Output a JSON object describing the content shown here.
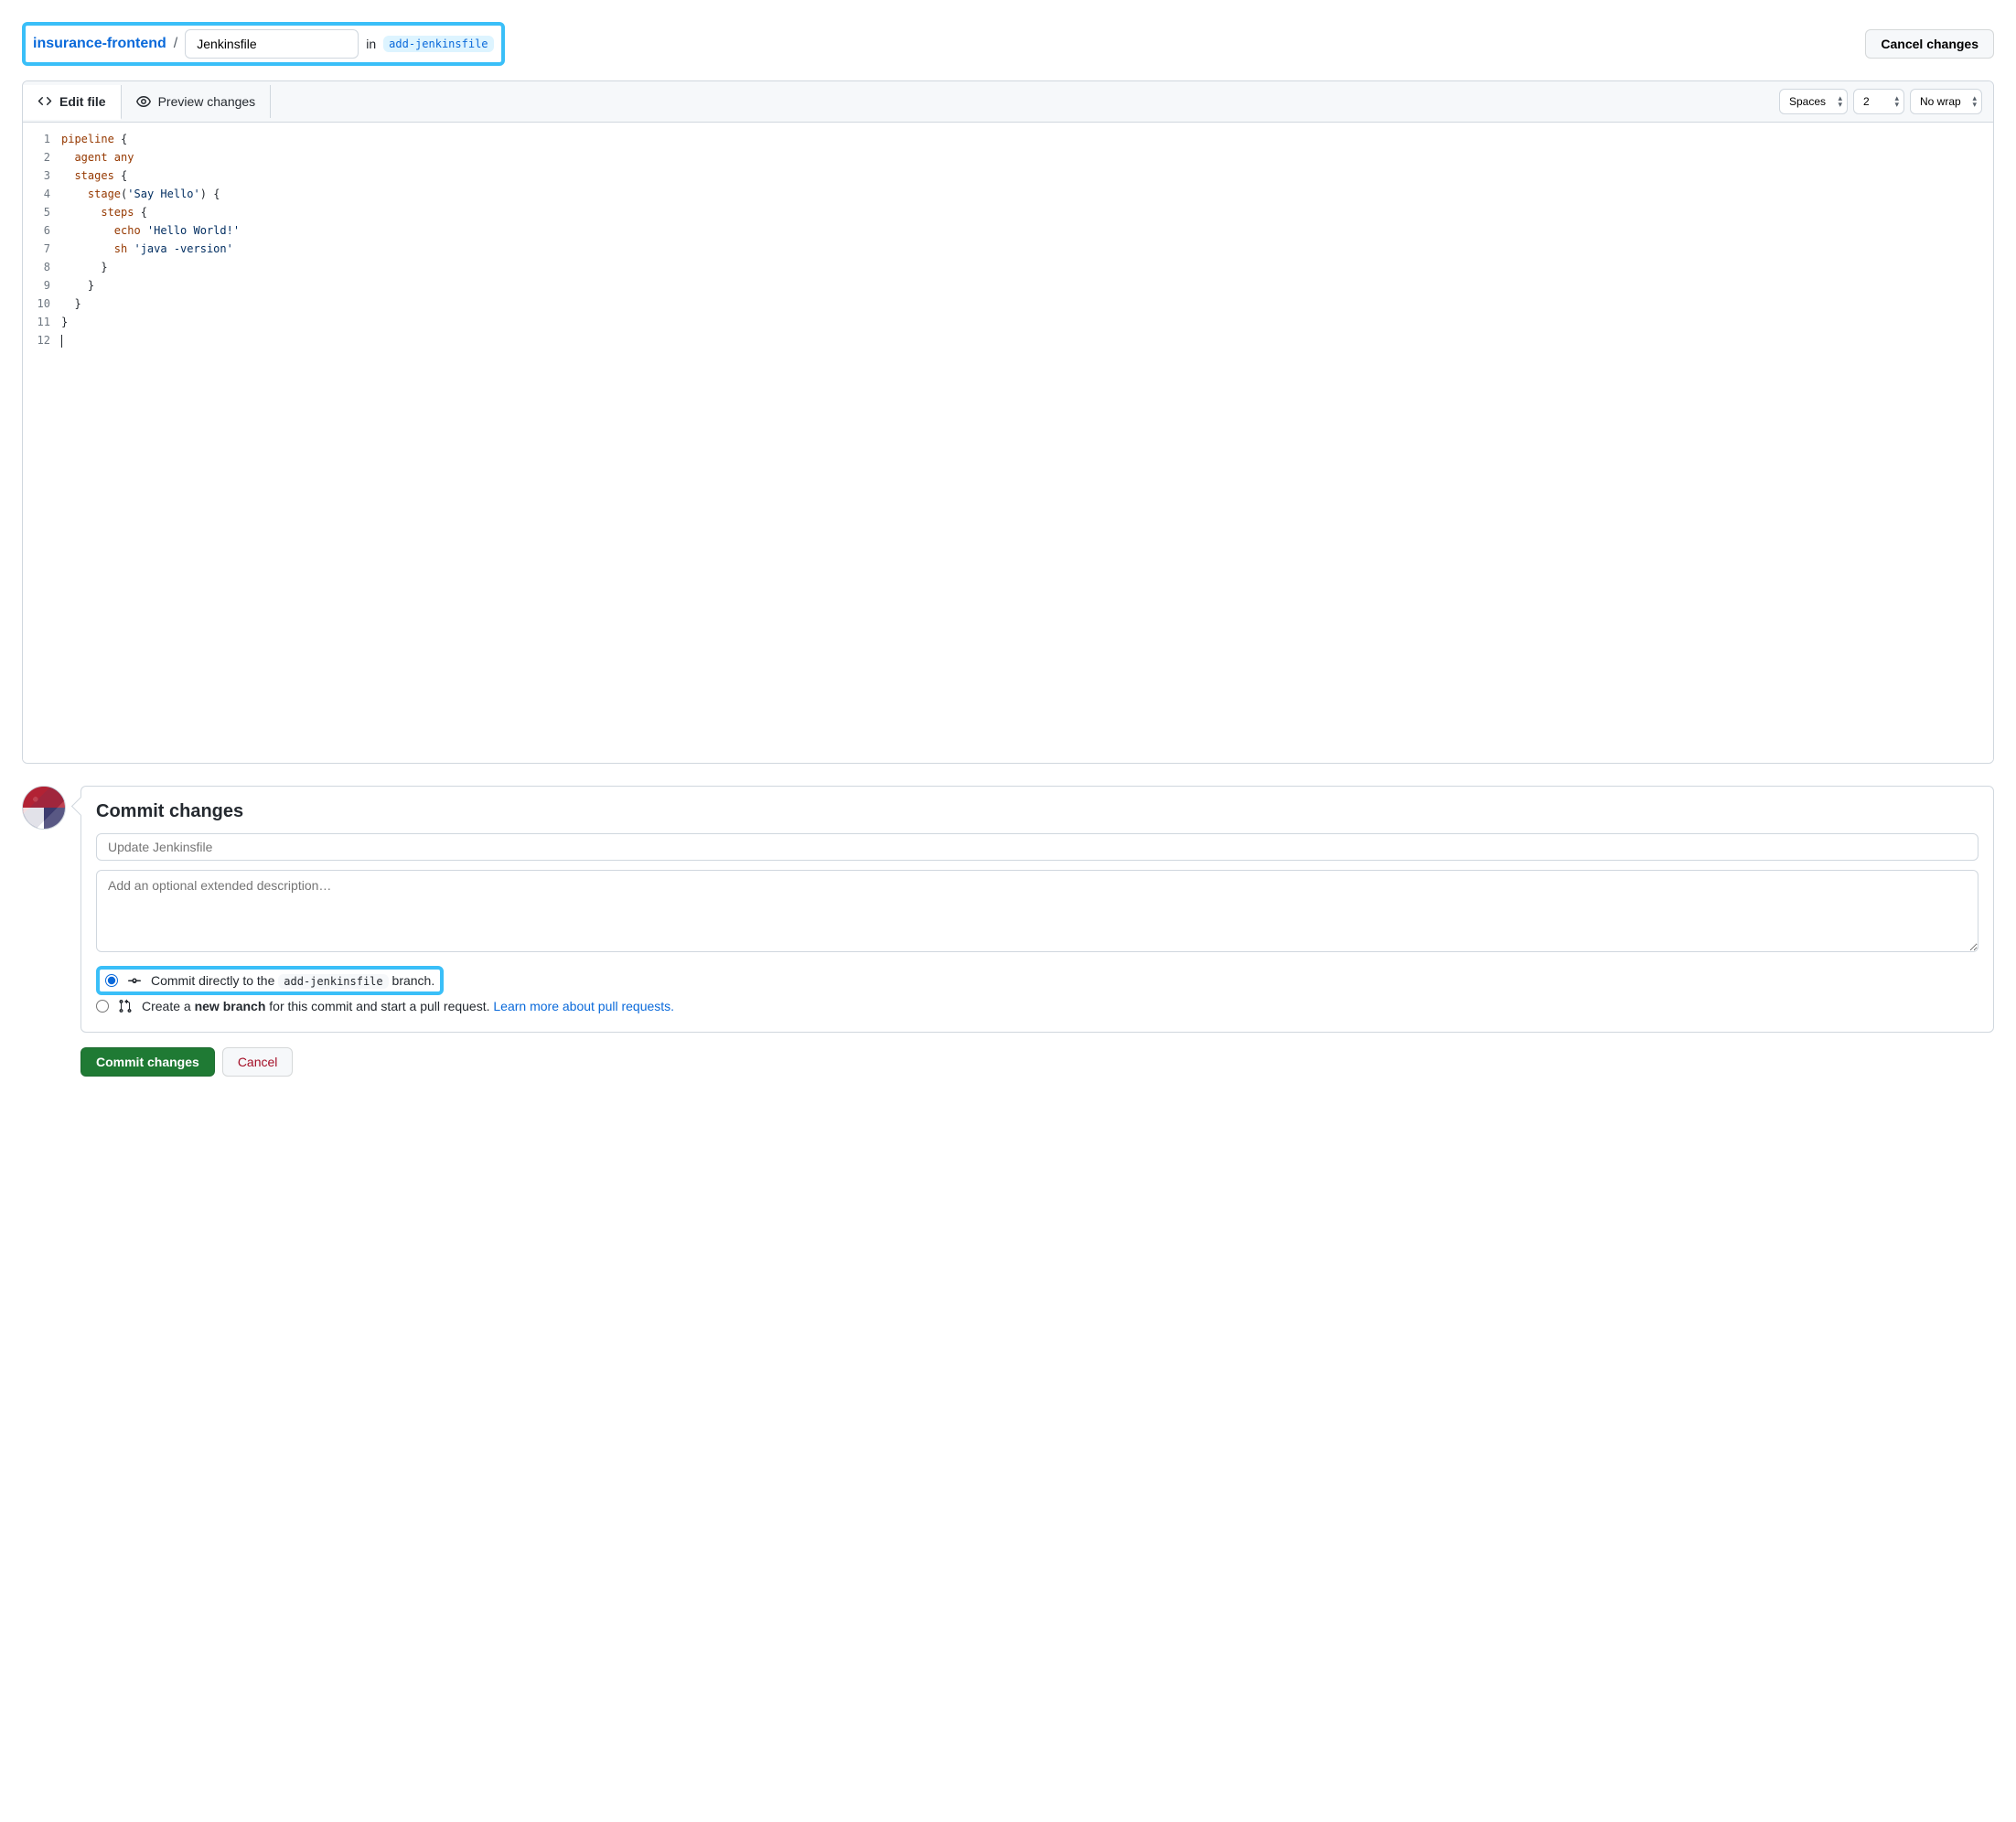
{
  "breadcrumb": {
    "repo": "insurance-frontend",
    "sep": "/",
    "filename": "Jenkinsfile",
    "in_label": "in",
    "branch": "add-jenkinsfile"
  },
  "top_actions": {
    "cancel": "Cancel changes"
  },
  "tabs": {
    "edit": "Edit file",
    "preview": "Preview changes"
  },
  "editor_controls": {
    "indent_mode": "Spaces",
    "indent_size": "2",
    "wrap": "No wrap"
  },
  "code": {
    "line_numbers": [
      "1",
      "2",
      "3",
      "4",
      "5",
      "6",
      "7",
      "8",
      "9",
      "10",
      "11",
      "12"
    ],
    "lines": [
      {
        "indent": "",
        "tokens": [
          {
            "t": "pipeline",
            "c": "tok-prop"
          },
          {
            "t": " {",
            "c": "tok-brace"
          }
        ]
      },
      {
        "indent": "  ",
        "tokens": [
          {
            "t": "agent any",
            "c": "tok-prop"
          }
        ]
      },
      {
        "indent": "  ",
        "tokens": [
          {
            "t": "stages",
            "c": "tok-prop"
          },
          {
            "t": " {",
            "c": "tok-brace"
          }
        ]
      },
      {
        "indent": "    ",
        "tokens": [
          {
            "t": "stage",
            "c": "tok-prop"
          },
          {
            "t": "(",
            "c": "tok-brace"
          },
          {
            "t": "'Say Hello'",
            "c": "tok-str"
          },
          {
            "t": ") {",
            "c": "tok-brace"
          }
        ]
      },
      {
        "indent": "      ",
        "tokens": [
          {
            "t": "steps",
            "c": "tok-prop"
          },
          {
            "t": " {",
            "c": "tok-brace"
          }
        ]
      },
      {
        "indent": "        ",
        "tokens": [
          {
            "t": "echo ",
            "c": "tok-prop"
          },
          {
            "t": "'Hello World!'",
            "c": "tok-str"
          }
        ]
      },
      {
        "indent": "        ",
        "tokens": [
          {
            "t": "sh ",
            "c": "tok-prop"
          },
          {
            "t": "'java -version'",
            "c": "tok-str"
          }
        ]
      },
      {
        "indent": "      ",
        "tokens": [
          {
            "t": "}",
            "c": "tok-brace"
          }
        ]
      },
      {
        "indent": "    ",
        "tokens": [
          {
            "t": "}",
            "c": "tok-brace"
          }
        ]
      },
      {
        "indent": "  ",
        "tokens": [
          {
            "t": "}",
            "c": "tok-brace"
          }
        ]
      },
      {
        "indent": "",
        "tokens": [
          {
            "t": "}",
            "c": "tok-brace"
          }
        ]
      },
      {
        "indent": "",
        "tokens": [],
        "cursor": true
      }
    ]
  },
  "commit": {
    "heading": "Commit changes",
    "summary_placeholder": "Update Jenkinsfile",
    "description_placeholder": "Add an optional extended description…",
    "opt_direct_pre": "Commit directly to the ",
    "opt_direct_branch": "add-jenkinsfile",
    "opt_direct_post": " branch.",
    "opt_newbranch_pre": "Create a ",
    "opt_newbranch_bold": "new branch",
    "opt_newbranch_post": " for this commit and start a pull request. ",
    "opt_newbranch_link": "Learn more about pull requests.",
    "commit_btn": "Commit changes",
    "cancel_btn": "Cancel"
  }
}
